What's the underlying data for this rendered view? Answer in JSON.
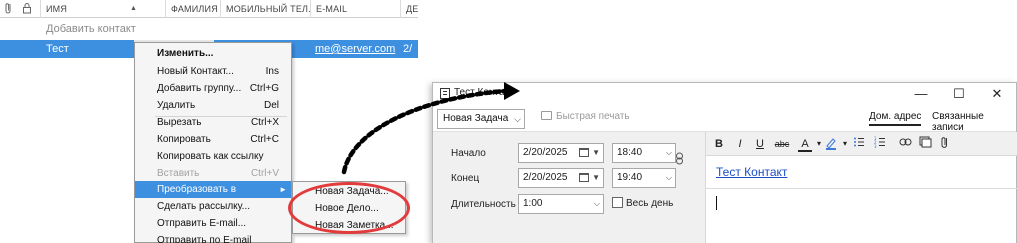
{
  "colors": {
    "selection": "#3d8fe0",
    "annotation": "#e23b3b",
    "link": "#1a4fc9"
  },
  "list": {
    "columns": [
      "ИМЯ",
      "ФАМИЛИЯ",
      "МОБИЛЬНЫЙ ТЕЛ.",
      "E-MAIL",
      "ДЕ"
    ],
    "header_icons": [
      "attachment-icon",
      "lock-icon"
    ],
    "add_row": "Добавить контакт",
    "selected_row": {
      "name": "Тест",
      "email": "me@server.com",
      "date_partial": "2/"
    }
  },
  "context_menu": {
    "items": [
      {
        "label": "Изменить...",
        "shortcut": ""
      },
      {
        "label": "Новый Контакт...",
        "shortcut": "Ins"
      },
      {
        "label": "Добавить группу...",
        "shortcut": "Ctrl+G"
      },
      {
        "label": "Удалить",
        "shortcut": "Del"
      },
      {
        "label": "Вырезать",
        "shortcut": "Ctrl+X"
      },
      {
        "label": "Копировать",
        "shortcut": "Ctrl+C"
      },
      {
        "label": "Копировать как ссылку",
        "shortcut": ""
      },
      {
        "label": "Вставить",
        "shortcut": "Ctrl+V"
      },
      {
        "label": "Преобразовать в",
        "shortcut": ""
      },
      {
        "label": "Сделать рассылку...",
        "shortcut": ""
      },
      {
        "label": "Отправить E-mail...",
        "shortcut": ""
      },
      {
        "label": "Отправить по E-mail",
        "shortcut": ""
      }
    ]
  },
  "submenu": {
    "items": [
      "Новая Задача...",
      "Новое Дело...",
      "Новая Заметка..."
    ]
  },
  "task_window": {
    "title": "Тест Контакт",
    "controls": {
      "minimize": "—",
      "maximize": "☐",
      "close": "✕"
    },
    "toolbar": {
      "type_select": "Новая Задача",
      "quick_print": "Быстрая печать",
      "tabs": [
        "Дом. адрес",
        "Связанные записи"
      ]
    },
    "fields": {
      "start_label": "Начало",
      "start_date": "2/20/2025",
      "start_time": "18:40",
      "end_label": "Конец",
      "end_date": "2/20/2025",
      "end_time": "19:40",
      "duration_label": "Длительность",
      "duration": "1:00",
      "all_day_label": "Весь день"
    },
    "format_bar": [
      "B",
      "I",
      "U",
      "abc",
      "A"
    ],
    "note_link": "Тест Контакт"
  }
}
